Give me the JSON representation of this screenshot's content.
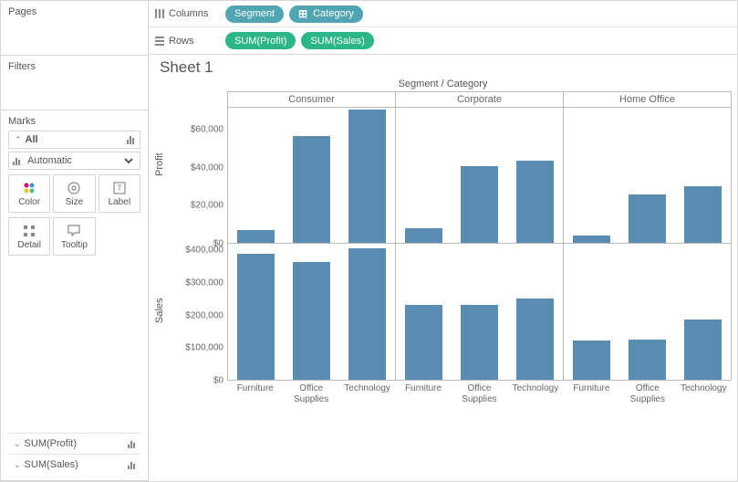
{
  "left": {
    "pages_title": "Pages",
    "filters_title": "Filters",
    "marks_title": "Marks",
    "all_label": "All",
    "mark_type": "Automatic",
    "buttons": {
      "color": "Color",
      "size": "Size",
      "label": "Label",
      "detail": "Detail",
      "tooltip": "Tooltip"
    },
    "measures": [
      "SUM(Profit)",
      "SUM(Sales)"
    ]
  },
  "shelves": {
    "columns_label": "Columns",
    "rows_label": "Rows",
    "columns": [
      "Segment",
      "Category"
    ],
    "rows": [
      "SUM(Profit)",
      "SUM(Sales)"
    ]
  },
  "sheet": {
    "title": "Sheet 1",
    "header": "Segment / Category",
    "segments": [
      "Consumer",
      "Corporate",
      "Home Office"
    ],
    "categories": [
      "Furniture",
      "Office Supplies",
      "Technology"
    ],
    "categories_display": [
      "Furniture",
      "Office\nSupplies",
      "Technology"
    ],
    "y1_title": "Profit",
    "y2_title": "Sales",
    "y1_ticks": [
      "$0",
      "$20,000",
      "$40,000",
      "$60,000"
    ],
    "y2_ticks": [
      "$0",
      "$100,000",
      "$200,000",
      "$300,000",
      "$400,000"
    ]
  },
  "chart_data": [
    {
      "type": "bar",
      "title": "Profit by Segment / Category",
      "ylabel": "Profit",
      "ylim": [
        0,
        72000
      ],
      "segments": [
        "Consumer",
        "Corporate",
        "Home Office"
      ],
      "categories": [
        "Furniture",
        "Office Supplies",
        "Technology"
      ],
      "values": {
        "Consumer": [
          7000,
          57000,
          71000
        ],
        "Corporate": [
          8000,
          41000,
          44000
        ],
        "Home Office": [
          4000,
          26000,
          30000
        ]
      }
    },
    {
      "type": "bar",
      "title": "Sales by Segment / Category",
      "ylabel": "Sales",
      "ylim": [
        0,
        420000
      ],
      "segments": [
        "Consumer",
        "Corporate",
        "Home Office"
      ],
      "categories": [
        "Furniture",
        "Office Supplies",
        "Technology"
      ],
      "values": {
        "Consumer": [
          390000,
          365000,
          405000
        ],
        "Corporate": [
          230000,
          230000,
          250000
        ],
        "Home Office": [
          120000,
          125000,
          185000
        ]
      }
    }
  ]
}
